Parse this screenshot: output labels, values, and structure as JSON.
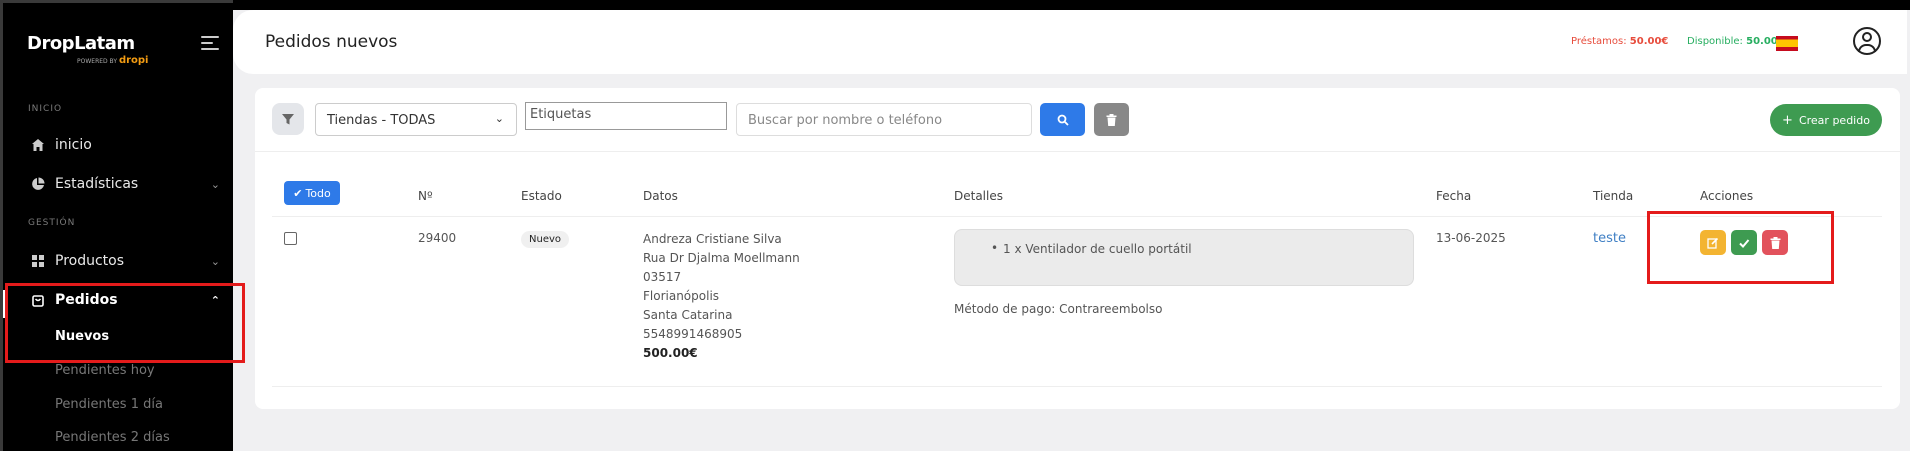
{
  "sidebar": {
    "logo": "DropLatam",
    "logo_sub_prefix": "POWERED BY",
    "logo_sub_brand": "dropi",
    "sections": [
      "INICIO",
      "GESTIÓN"
    ],
    "items": [
      {
        "label": "inicio",
        "icon": "home-icon"
      },
      {
        "label": "Estadísticas",
        "icon": "pie-chart-icon"
      },
      {
        "label": "Productos",
        "icon": "grid-icon"
      },
      {
        "label": "Pedidos",
        "icon": "shopping-bag-icon"
      }
    ],
    "subitems": [
      "Nuevos",
      "Pendientes hoy",
      "Pendientes 1 día",
      "Pendientes 2 días"
    ]
  },
  "header": {
    "title": "Pedidos nuevos",
    "loan_label": "Préstamos:",
    "loan_value": "50.00€",
    "avail_label": "Disponible:",
    "avail_value": "50.00€"
  },
  "toolbar": {
    "store_select": "Tiendas - TODAS",
    "tags_placeholder": "Etiquetas",
    "search_placeholder": "Buscar por nombre o teléfono",
    "create_label": "Crear pedido"
  },
  "table": {
    "select_all": "Todo",
    "headers": [
      "Nº",
      "Estado",
      "Datos",
      "Detalles",
      "Fecha",
      "Tienda",
      "Acciones"
    ],
    "row": {
      "number": "29400",
      "status": "Nuevo",
      "name": "Andreza Cristiane Silva",
      "street": "Rua Dr Djalma Moellmann",
      "zip": "03517",
      "city": "Florianópolis",
      "state": "Santa Catarina",
      "phone": "5548991468905",
      "total": "500.00€",
      "detail_item": "1 x Ventilador de cuello portátil",
      "payment": "Método de pago: Contrareembolso",
      "date": "13-06-2025",
      "store": "teste"
    }
  },
  "colors": {
    "primary": "#2e7ae8",
    "success": "#3e9b51",
    "warning": "#f3b431",
    "danger": "#e2525c",
    "annotation": "#e41b1b"
  }
}
